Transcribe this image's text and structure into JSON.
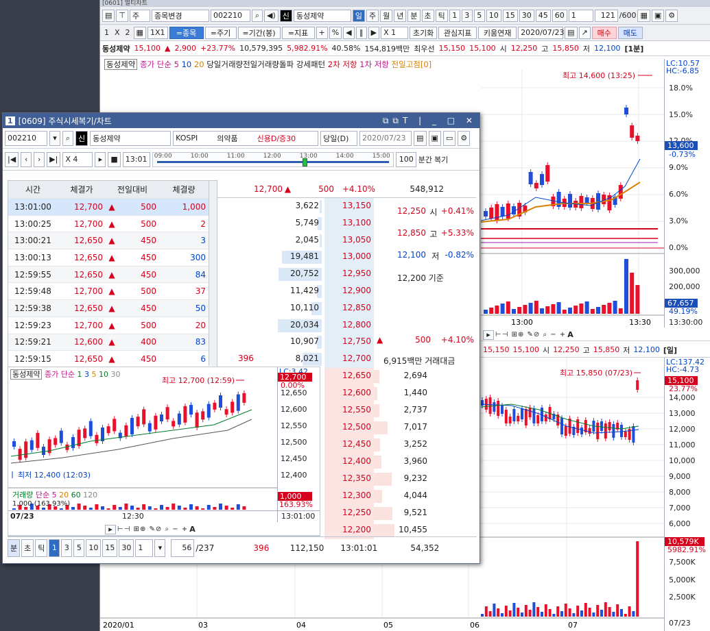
{
  "main_window": {
    "title_fragment": "[0601] 멀티차트",
    "toolbar1": {
      "type_select": "주",
      "change_select": "종목변경",
      "code": "002210",
      "stock_badge": "신",
      "stock_name": "동성제약",
      "periods": [
        "일",
        "주",
        "월",
        "년",
        "분",
        "초",
        "틱"
      ],
      "active_period": "일",
      "minutes": [
        "1",
        "3",
        "5",
        "10",
        "15",
        "30",
        "45",
        "60"
      ],
      "count_sel": "1",
      "page_pos": "121",
      "page_total": "/600"
    },
    "toolbar2": {
      "layout_labels": [
        "1",
        "X",
        "2"
      ],
      "scale": "1X1",
      "eq_item": "=종목",
      "eq_period": "=주기",
      "eq_range": "=기간(봉)",
      "eq_indicator": "=지표",
      "plus": "+",
      "pct": "%",
      "zoom": "X 1",
      "reset": "초기화",
      "watch": "관심지표",
      "kiwoom": "키움연재",
      "date": "2020/07/23",
      "buy": "매수",
      "sell": "매도"
    },
    "quote": {
      "name": "동성제약",
      "price": "15,100",
      "change": "2,900",
      "change_pct": "+23.77%",
      "volume": "10,579,395",
      "vol_pct": "5,982.91%",
      "turnover": "40.58%",
      "amount": "154,819백만",
      "pref_label": "최우선",
      "ask": "15,150",
      "bid": "15,100",
      "open_l": "시",
      "open": "12,250",
      "high_l": "고",
      "high": "15,850",
      "low_l": "저",
      "low": "12,100",
      "period_tag": "[1분]"
    },
    "legend": {
      "name": "동성제약",
      "ma_label": "종가 단순",
      "ma5": "5",
      "ma10": "10",
      "ma20": "20",
      "prev_vol": "당일거래량전일거래량돌파 강세패턴",
      "r2": "2차 저항",
      "r1": "1차 저항",
      "prev_high": "전일고점[0]"
    },
    "minute_chart": {
      "peak_label": "최고 14,600 (13:25)",
      "lc": "LC:10.57",
      "hc": "HC:-6.85",
      "price_tag": "13,600",
      "pct_tag": "-0.73%",
      "pct_ticks": [
        "18.0%",
        "15.0%",
        "12.0%",
        "9.0%",
        "6.0%",
        "3.0%",
        "0.0%"
      ],
      "vol_ticks": [
        "300,000",
        "200,000"
      ],
      "vol_tag": "67,657",
      "vol_pct": "49.19%",
      "x_labels": [
        "13:00",
        "13:30",
        "13:30:00"
      ]
    },
    "daily_strip": {
      "ask": "15,150",
      "bid": "15,100",
      "open_l": "시",
      "open": "12,250",
      "high_l": "고",
      "high": "15,850",
      "low_l": "저",
      "low": "12,100",
      "tag": "[일]"
    },
    "daily_chart": {
      "peak_label": "최고 15,850 (07/23)",
      "lc": "LC:137.42",
      "hc": "HC:-4.73",
      "price_tag": "15,100",
      "pct_tag": "23.77%",
      "ticks": [
        "14,000",
        "13,000",
        "12,000",
        "11,000",
        "10,000",
        "9,000",
        "8,000",
        "7,000",
        "6,000"
      ],
      "vol_tag": "10,579K",
      "vol_pct": "5982.91%",
      "vol_ticks": [
        "7,500K",
        "5,000K",
        "2,500K"
      ],
      "x_labels": [
        "2020/01",
        "03",
        "04",
        "05",
        "06",
        "07",
        "07/23"
      ]
    }
  },
  "popup": {
    "title": "[0609] 주식시세복기/차트",
    "code": "002210",
    "badge": "신",
    "name": "동성제약",
    "market": "KOSPI",
    "sector": "의약품",
    "credit": "신용D/증30",
    "day_sel": "당일(D)",
    "date": "2020/07/23",
    "speed": "X 4",
    "time": "13:01",
    "timeline": [
      "09:00",
      "10:00",
      "11:00",
      "12:00",
      "13:00",
      "14:00",
      "15:00"
    ],
    "interval": "100",
    "interval_label": "분간",
    "replay": "복기",
    "trade_headers": [
      "시간",
      "체결가",
      "전일대비",
      "체결량"
    ],
    "trades": [
      {
        "time": "13:01:00",
        "price": "12,700",
        "diff": "500",
        "qty": "1,000",
        "qcolor": "red"
      },
      {
        "time": "13:00:25",
        "price": "12,700",
        "diff": "500",
        "qty": "2",
        "qcolor": "red"
      },
      {
        "time": "13:00:21",
        "price": "12,650",
        "diff": "450",
        "qty": "3",
        "qcolor": "blue"
      },
      {
        "time": "13:00:13",
        "price": "12,650",
        "diff": "450",
        "qty": "300",
        "qcolor": "blue"
      },
      {
        "time": "12:59:55",
        "price": "12,650",
        "diff": "450",
        "qty": "84",
        "qcolor": "blue"
      },
      {
        "time": "12:59:48",
        "price": "12,700",
        "diff": "500",
        "qty": "37",
        "qcolor": "red"
      },
      {
        "time": "12:59:38",
        "price": "12,650",
        "diff": "450",
        "qty": "50",
        "qcolor": "blue"
      },
      {
        "time": "12:59:23",
        "price": "12,700",
        "diff": "500",
        "qty": "20",
        "qcolor": "red"
      },
      {
        "time": "12:59:21",
        "price": "12,600",
        "diff": "400",
        "qty": "83",
        "qcolor": "blue"
      },
      {
        "time": "12:59:15",
        "price": "12,650",
        "diff": "450",
        "qty": "6",
        "qcolor": "blue"
      }
    ],
    "ob_header": {
      "price": "12,700",
      "change": "500",
      "pct": "+4.10%",
      "volume": "548,912"
    },
    "asks": [
      {
        "qty": "3,622",
        "price": "13,150",
        "fill": 0.02
      },
      {
        "qty": "5,749",
        "price": "13,100",
        "fill": 0.04
      },
      {
        "qty": "2,045",
        "price": "13,050",
        "fill": 0.02
      },
      {
        "qty": "19,481",
        "price": "13,000",
        "fill": 0.39
      },
      {
        "qty": "20,752",
        "price": "12,950",
        "fill": 0.42
      },
      {
        "qty": "11,429",
        "price": "12,900",
        "fill": 0.05
      },
      {
        "qty": "10,110",
        "price": "12,850",
        "fill": 0.1
      },
      {
        "qty": "20,034",
        "price": "12,800",
        "fill": 0.43
      },
      {
        "qty": "10,907",
        "price": "12,750",
        "fill": 0.05
      },
      {
        "qty": "8,021",
        "price": "12,700",
        "fill": 0.19,
        "left": "396"
      }
    ],
    "bids": [
      {
        "price": "12,650",
        "qty": "2,694",
        "fill": 0.05
      },
      {
        "price": "12,600",
        "qty": "1,440",
        "fill": 0.03
      },
      {
        "price": "12,550",
        "qty": "2,737",
        "fill": 0.05
      },
      {
        "price": "12,500",
        "qty": "7,017",
        "fill": 0.13
      },
      {
        "price": "12,450",
        "qty": "3,252",
        "fill": 0.06
      },
      {
        "price": "12,400",
        "qty": "3,960",
        "fill": 0.07
      },
      {
        "price": "12,350",
        "qty": "9,232",
        "fill": 0.17
      },
      {
        "price": "12,300",
        "qty": "4,044",
        "fill": 0.08
      },
      {
        "price": "12,250",
        "qty": "9,521",
        "fill": 0.18
      },
      {
        "price": "12,200",
        "qty": "10,455",
        "fill": 0.2
      }
    ],
    "info": {
      "open": "12,250",
      "open_l": "시",
      "open_pct": "+0.41%",
      "high": "12,850",
      "high_l": "고",
      "high_pct": "+5.33%",
      "low": "12,100",
      "low_l": "저",
      "low_pct": "-0.82%",
      "base": "12,200 기준",
      "chg": "500",
      "chg_pct": "+4.10%",
      "amount": "6,915백만 거래대금"
    },
    "mini_chart": {
      "legend_name": "동성제약",
      "ma_label": "종가 단순",
      "ma": [
        "1",
        "3",
        "5",
        "10",
        "30"
      ],
      "peak": "최고 12,700 (12:59)",
      "low": "최저 12,400 (12:03)",
      "lc": "LC:3.42",
      "price_tag": "12,700",
      "pct_tag": "0.00%",
      "ticks": [
        "12,650",
        "12,600",
        "12,550",
        "12,500",
        "12,450",
        "12,400"
      ],
      "vol_legend": "거래량",
      "vol_ma_label": "단순",
      "vol_ma": [
        "5",
        "20",
        "60",
        "120"
      ],
      "vol_value": "1,000 (163.93%)",
      "vol_tag": "1,000",
      "vol_pct": "163.93%",
      "x_labels": [
        "07/23",
        "12:30",
        "13:01:00"
      ]
    },
    "bottom": {
      "periods": [
        "분",
        "초",
        "틱"
      ],
      "active": "1",
      "mins": [
        "1",
        "3",
        "5",
        "10",
        "15",
        "30"
      ],
      "cnt": "1",
      "page": "56",
      "total": "/237",
      "left_total": "396",
      "ask_total": "112,150",
      "time": "13:01:01",
      "bid_total": "54,352"
    }
  }
}
